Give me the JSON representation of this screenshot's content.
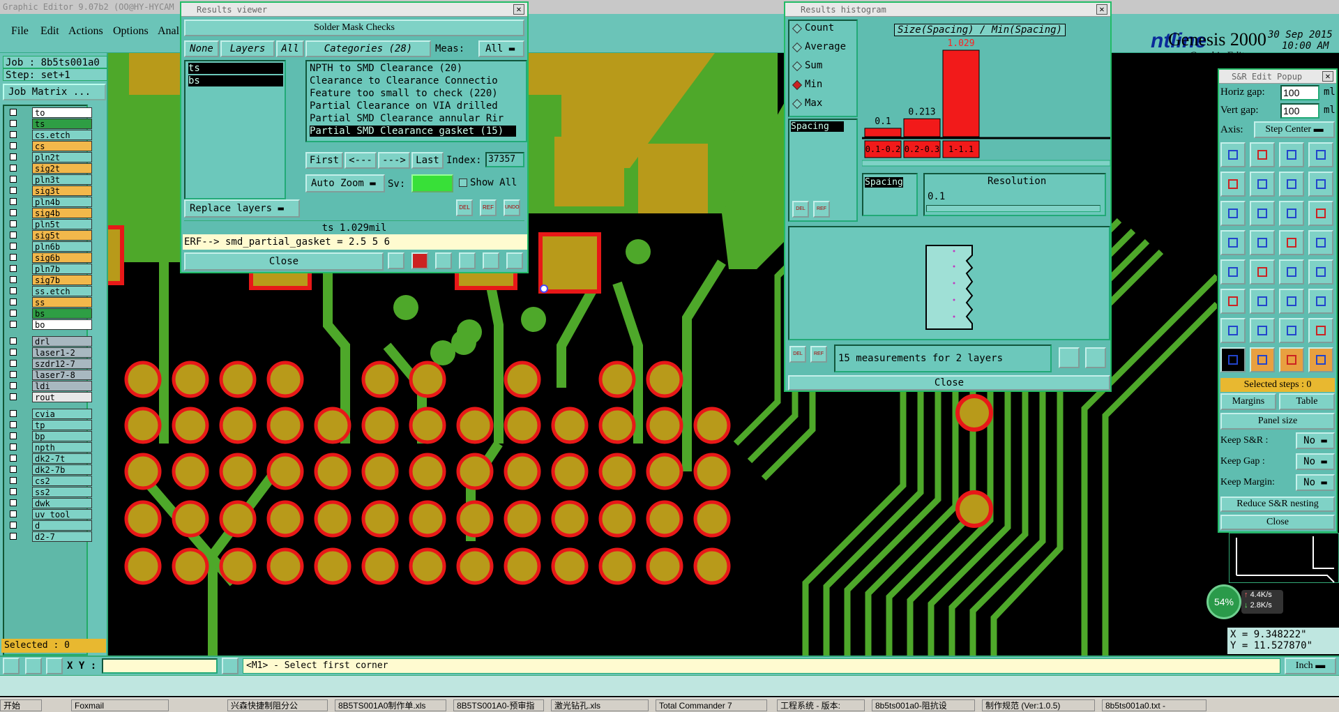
{
  "window_title": "Graphic Editor 9.07b2  (OO@HY-HYCAM",
  "menu": [
    "File",
    "Edit",
    "Actions",
    "Options",
    "Anal"
  ],
  "brand": {
    "logo": "ntline",
    "product": "Genesis 2000",
    "sub": "Graphic Editor",
    "date": "30 Sep 2015",
    "time": "10:00 AM"
  },
  "job": {
    "job": "Job : 8b5ts001a0",
    "step": "Step: set+1",
    "matrix_btn": "Job Matrix ..."
  },
  "layers": [
    {
      "name": "to",
      "color": "#ffffff"
    },
    {
      "name": "ts",
      "color": "#2e9e44"
    },
    {
      "name": "cs.etch",
      "color": "#7fd2c6"
    },
    {
      "name": "cs",
      "color": "#f2b84b"
    },
    {
      "name": "pln2t",
      "color": "#7fd2c6"
    },
    {
      "name": "sig2t",
      "color": "#f2b84b"
    },
    {
      "name": "pln3t",
      "color": "#7fd2c6"
    },
    {
      "name": "sig3t",
      "color": "#f2b84b"
    },
    {
      "name": "pln4b",
      "color": "#7fd2c6"
    },
    {
      "name": "sig4b",
      "color": "#f2b84b"
    },
    {
      "name": "pln5t",
      "color": "#7fd2c6"
    },
    {
      "name": "sig5t",
      "color": "#f2b84b"
    },
    {
      "name": "pln6b",
      "color": "#7fd2c6"
    },
    {
      "name": "sig6b",
      "color": "#f2b84b"
    },
    {
      "name": "pln7b",
      "color": "#7fd2c6"
    },
    {
      "name": "sig7b",
      "color": "#f2b84b"
    },
    {
      "name": "ss.etch",
      "color": "#7fd2c6"
    },
    {
      "name": "ss",
      "color": "#f2b84b"
    },
    {
      "name": "bs",
      "color": "#2e9e44"
    },
    {
      "name": "bo",
      "color": "#ffffff"
    },
    {
      "name": "drl",
      "color": "#a8b8c0"
    },
    {
      "name": "laser1-2",
      "color": "#a8b8c0"
    },
    {
      "name": "szdr12-7",
      "color": "#a8b8c0"
    },
    {
      "name": "laser7-8",
      "color": "#a8b8c0"
    },
    {
      "name": "ldi",
      "color": "#a8b8c0"
    },
    {
      "name": "rout",
      "color": "#e8e8e8"
    },
    {
      "name": "cvia",
      "color": "#7fd2c6"
    },
    {
      "name": "tp",
      "color": "#7fd2c6"
    },
    {
      "name": "bp",
      "color": "#7fd2c6"
    },
    {
      "name": "npth",
      "color": "#7fd2c6"
    },
    {
      "name": "dk2-7t",
      "color": "#7fd2c6"
    },
    {
      "name": "dk2-7b",
      "color": "#7fd2c6"
    },
    {
      "name": "cs2",
      "color": "#7fd2c6"
    },
    {
      "name": "ss2",
      "color": "#7fd2c6"
    },
    {
      "name": "dwk",
      "color": "#7fd2c6"
    },
    {
      "name": "uv_tool",
      "color": "#7fd2c6"
    },
    {
      "name": "d",
      "color": "#7fd2c6"
    },
    {
      "name": "d2-7",
      "color": "#7fd2c6"
    }
  ],
  "selected_count": "Selected : 0",
  "results_viewer": {
    "title": "Results viewer",
    "header": "Solder Mask Checks",
    "none": "None",
    "layers_tab": "Layers",
    "all": "All",
    "categories": "Categories (28)",
    "meas_label": "Meas:",
    "meas_value": "All",
    "layer_items": [
      "ts",
      "bs"
    ],
    "cat_items": [
      "NPTH to SMD Clearance (20)",
      "Clearance to Clearance Connectio",
      "Feature too small to check (220)",
      "Partial Clearance on VIA drilled",
      "Partial SMD Clearance annular Rir",
      "Partial SMD Clearance gasket (15)"
    ],
    "first": "First",
    "prev": "<---",
    "next": "--->",
    "last": "Last",
    "index_label": "Index:",
    "index_value": "37357",
    "auto_zoom": "Auto Zoom",
    "sv": "Sv:",
    "show_all": "Show All",
    "replace_layers": "Replace layers",
    "del": "DEL",
    "ref": "REF",
    "undo": "UNDO",
    "measure": "ts 1.029mil",
    "erf": "ERF--> smd_partial_gasket = 2.5 5 6",
    "close": "Close"
  },
  "histogram": {
    "title": "Results histogram",
    "chart_title": "Size(Spacing) / Min(Spacing)",
    "modes": [
      "Count",
      "Average",
      "Sum",
      "Min",
      "Max"
    ],
    "selected_mode": "Min",
    "spacing": "Spacing",
    "resolution": "Resolution",
    "res_value": "0.1",
    "measurements": "15 measurements for 2 layers",
    "close": "Close",
    "del": "DEL",
    "ref": "REF"
  },
  "chart_data": {
    "type": "bar",
    "title": "Size(Spacing) / Min(Spacing)",
    "categories": [
      "0.1-0.2",
      "0.2-0.3",
      "1-1.1"
    ],
    "values": [
      0.1,
      0.213,
      1.029
    ],
    "labels": [
      "0.1",
      "0.213",
      "1.029"
    ],
    "ylim": [
      0,
      1.029
    ]
  },
  "sr_panel": {
    "title": "S&R Edit Popup",
    "hgap_label": "Horiz gap:",
    "hgap": "100",
    "vgap_label": "Vert  gap:",
    "vgap": "100",
    "unit": "ml",
    "axis_label": "Axis:",
    "axis_value": "Step Center",
    "selected_steps": "Selected steps : 0",
    "margins": "Margins",
    "table": "Table",
    "panel_size": "Panel size",
    "keep_sr": "Keep S&R  :",
    "keep_gap": "Keep Gap  :",
    "keep_margin": "Keep Margin:",
    "no": "No",
    "reduce": "Reduce S&R nesting",
    "close": "Close"
  },
  "net": {
    "percent": "54%",
    "up": "4.4K/s",
    "down": "2.8K/s"
  },
  "coords": {
    "x": "X = 9.348222\"",
    "y": "Y = 11.527870\""
  },
  "bottom": {
    "xy_label": "X Y :",
    "prompt": "<M1> - Select first corner",
    "unit": "Inch"
  },
  "taskbar": [
    "开始",
    "Foxmail",
    "兴森快捷制阻分公",
    "8B5TS001A0制作单.xls",
    "8B5TS001A0-预审指",
    "激光钻孔.xls",
    "Total Commander 7",
    "工程系统 - 版本:",
    "8b5ts001a0-阻抗设",
    "制作规范 (Ver:1.0.5)",
    "8b5ts001a0.txt -"
  ]
}
